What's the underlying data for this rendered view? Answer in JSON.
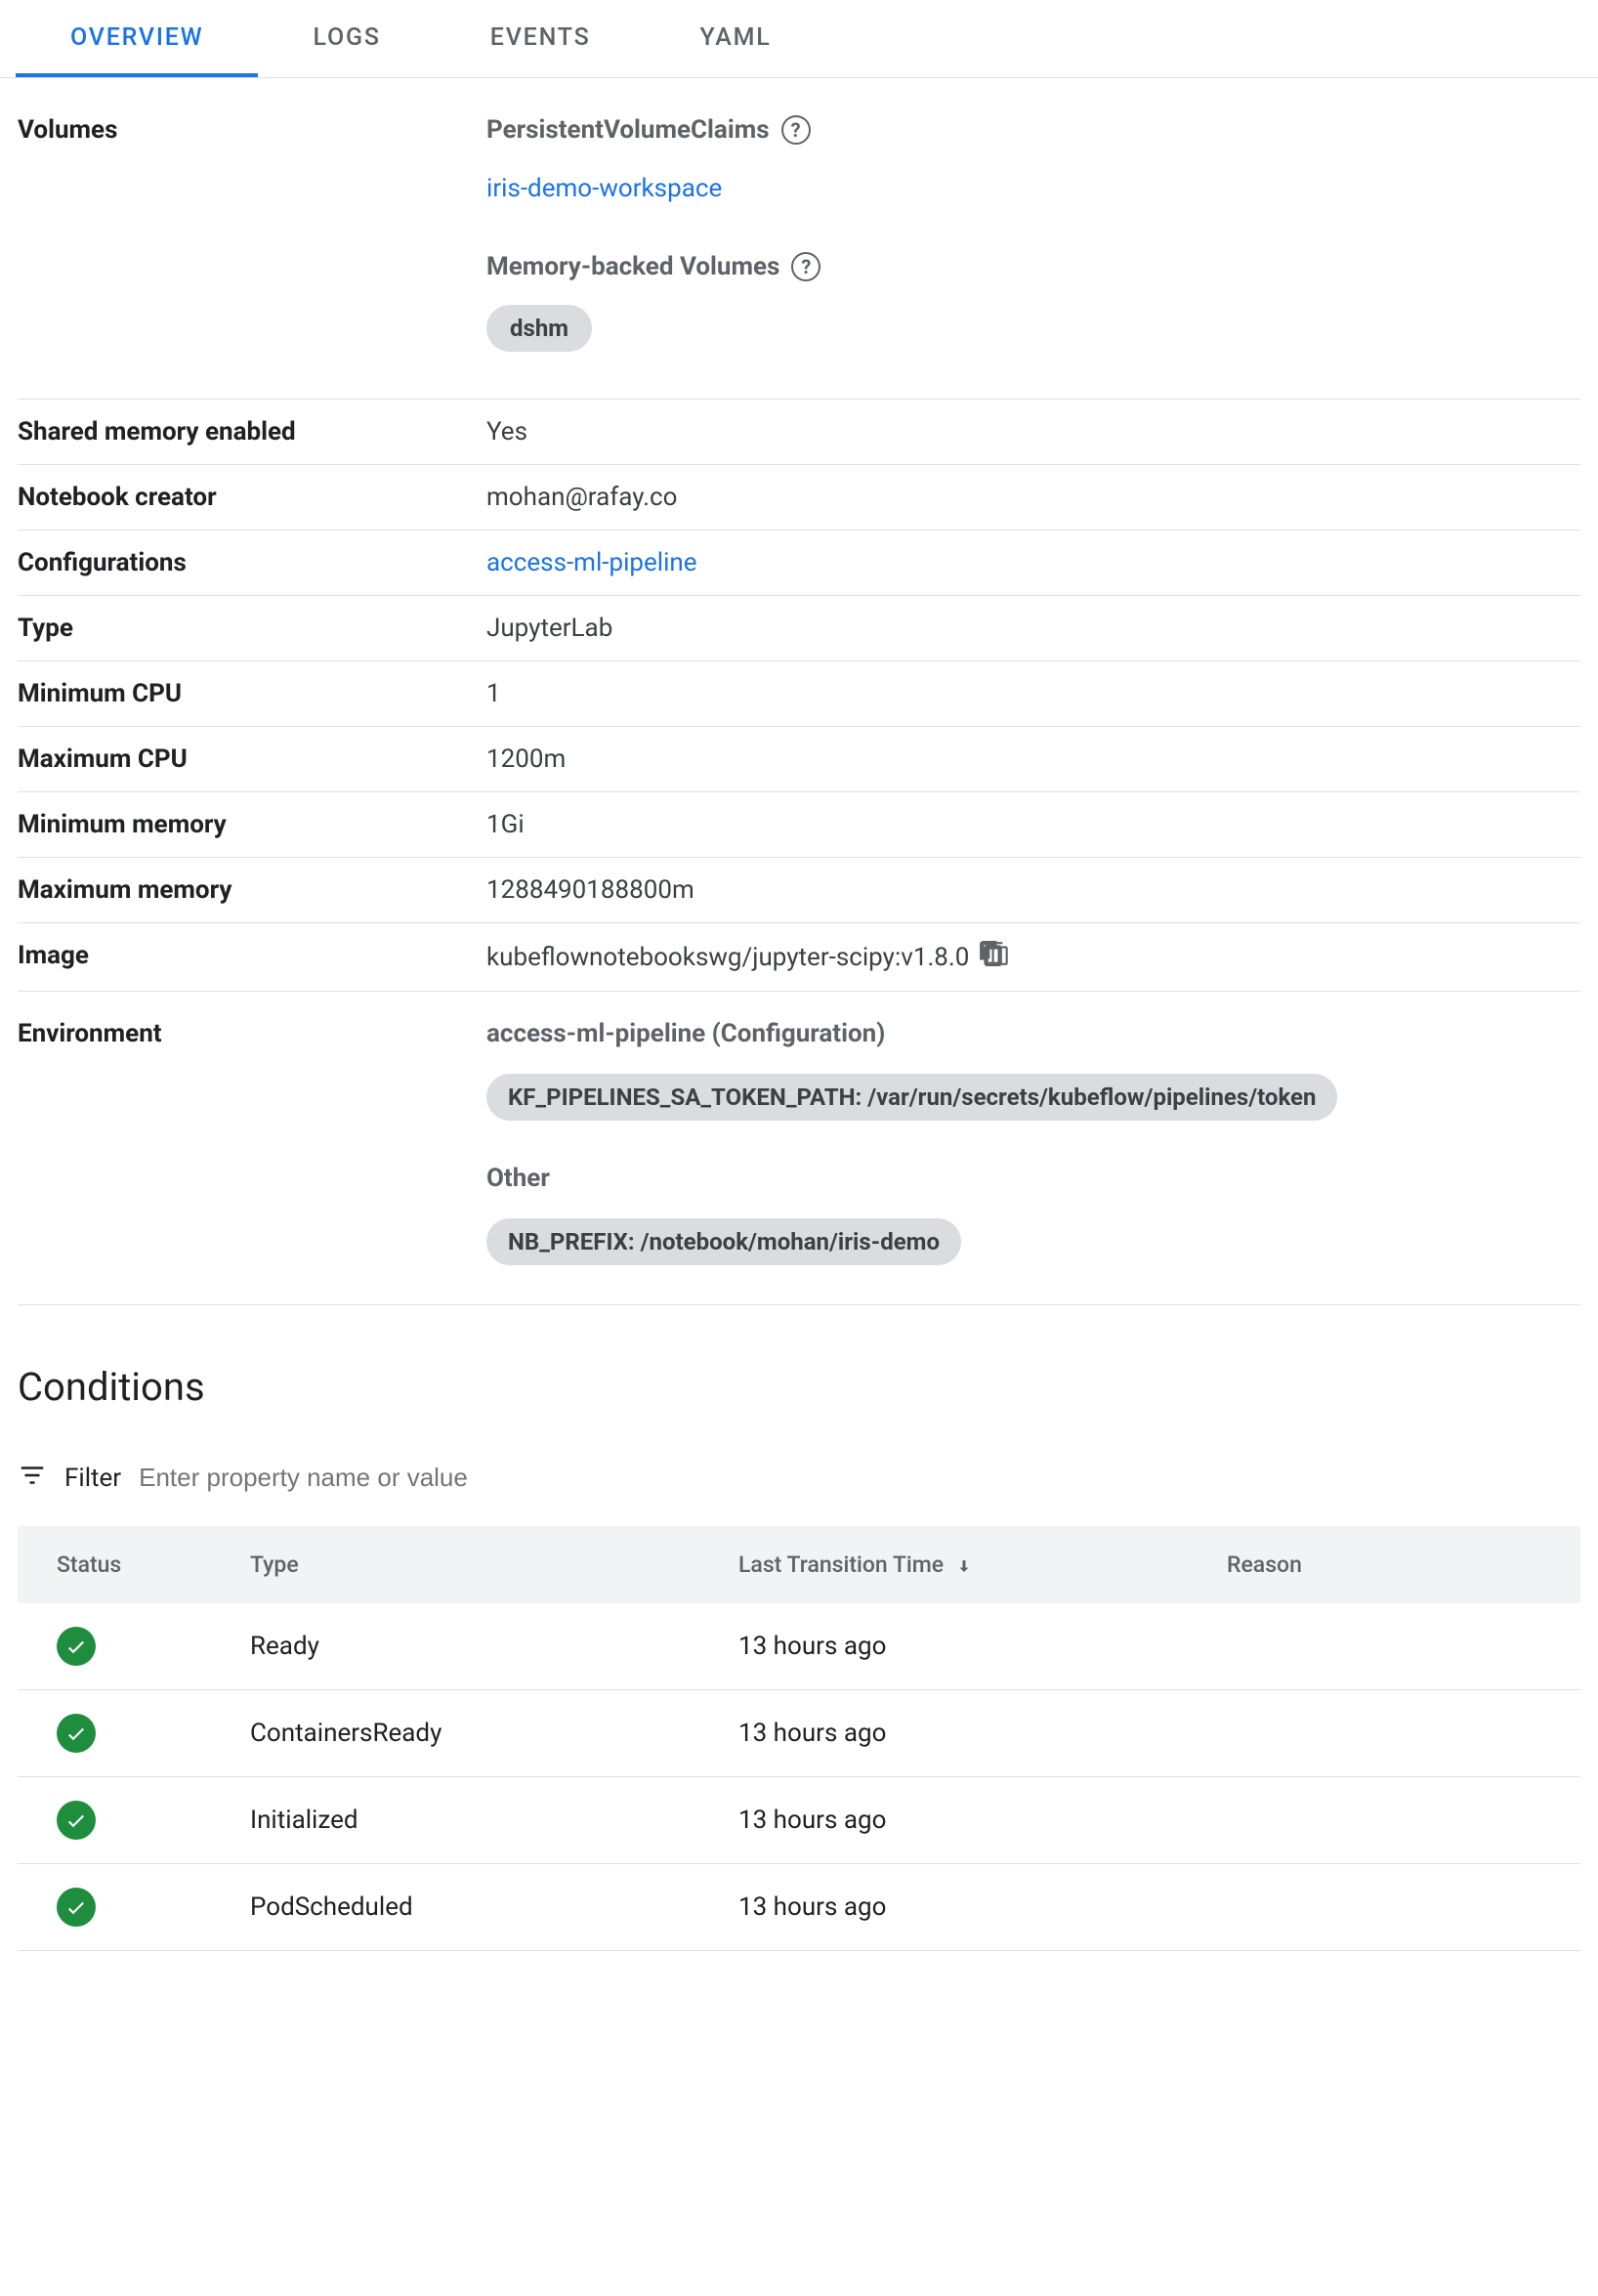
{
  "tabs": [
    {
      "label": "OVERVIEW",
      "active": true
    },
    {
      "label": "LOGS",
      "active": false
    },
    {
      "label": "EVENTS",
      "active": false
    },
    {
      "label": "YAML",
      "active": false
    }
  ],
  "volumes": {
    "label": "Volumes",
    "pvc": {
      "heading": "PersistentVolumeClaims",
      "items": [
        "iris-demo-workspace"
      ]
    },
    "memory": {
      "heading": "Memory-backed Volumes",
      "items": [
        "dshm"
      ]
    }
  },
  "rows": {
    "shared_memory": {
      "label": "Shared memory enabled",
      "value": "Yes"
    },
    "creator": {
      "label": "Notebook creator",
      "value": "mohan@rafay.co"
    },
    "configurations": {
      "label": "Configurations",
      "value": "access-ml-pipeline"
    },
    "type": {
      "label": "Type",
      "value": "JupyterLab"
    },
    "min_cpu": {
      "label": "Minimum CPU",
      "value": "1"
    },
    "max_cpu": {
      "label": "Maximum CPU",
      "value": "1200m"
    },
    "min_mem": {
      "label": "Minimum memory",
      "value": "1Gi"
    },
    "max_mem": {
      "label": "Maximum memory",
      "value": "1288490188800m"
    },
    "image": {
      "label": "Image",
      "value": "kubeflownotebookswg/jupyter-scipy:v1.8.0"
    },
    "environment": {
      "label": "Environment",
      "groups": [
        {
          "title": "access-ml-pipeline (Configuration)",
          "vars": [
            "KF_PIPELINES_SA_TOKEN_PATH: /var/run/secrets/kubeflow/pipelines/token"
          ]
        },
        {
          "title": "Other",
          "vars": [
            "NB_PREFIX: /notebook/mohan/iris-demo"
          ]
        }
      ]
    }
  },
  "conditions": {
    "title": "Conditions",
    "filter": {
      "label": "Filter",
      "placeholder": "Enter property name or value"
    },
    "columns": {
      "status": "Status",
      "type": "Type",
      "time": "Last Transition Time",
      "reason": "Reason"
    },
    "rows": [
      {
        "status": "ok",
        "type": "Ready",
        "time": "13 hours ago",
        "reason": ""
      },
      {
        "status": "ok",
        "type": "ContainersReady",
        "time": "13 hours ago",
        "reason": ""
      },
      {
        "status": "ok",
        "type": "Initialized",
        "time": "13 hours ago",
        "reason": ""
      },
      {
        "status": "ok",
        "type": "PodScheduled",
        "time": "13 hours ago",
        "reason": ""
      }
    ]
  }
}
